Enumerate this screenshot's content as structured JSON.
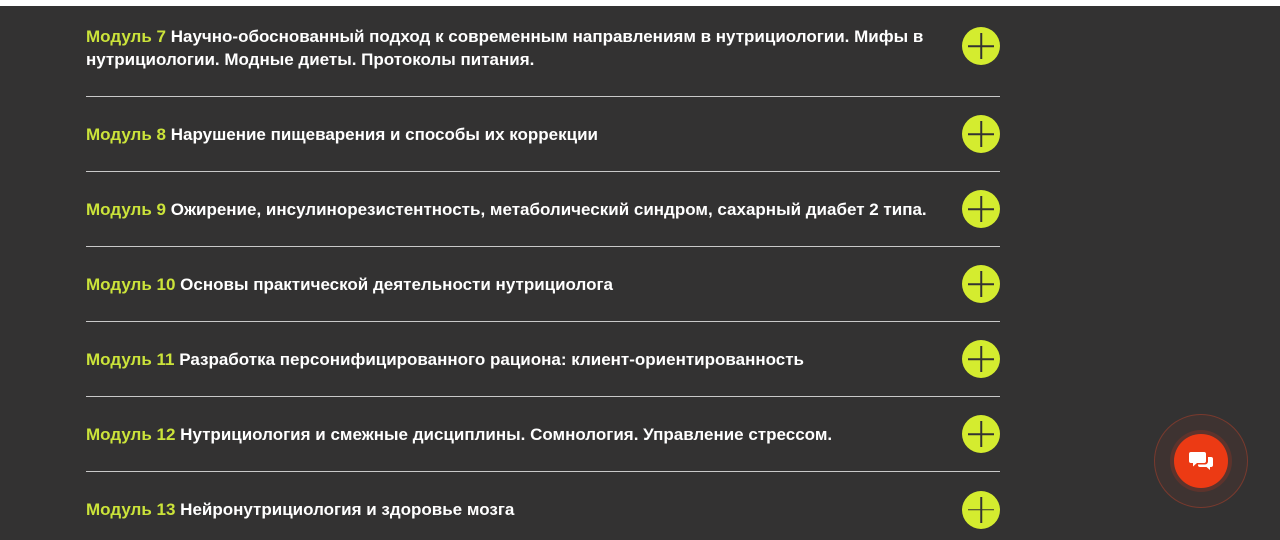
{
  "modules": [
    {
      "num": "Модуль 7",
      "title": "Научно-обоснованный подход к современным направлениям в нутрициологии. Мифы в нутрициологии. Модные диеты. Протоколы питания."
    },
    {
      "num": "Модуль 8",
      "title": "Нарушение пищеварения и способы их коррекции"
    },
    {
      "num": "Модуль 9",
      "title": "Ожирение, инсулинорезистентность, метаболический синдром, сахарный диабет 2 типа."
    },
    {
      "num": "Модуль 10",
      "title": "Основы практической деятельности нутрициолога"
    },
    {
      "num": "Модуль 11",
      "title": "Разработка персонифицированного рациона: клиент-ориентированность"
    },
    {
      "num": "Модуль 12",
      "title": "Нутрициология и смежные дисциплины. Сомнология. Управление стрессом."
    },
    {
      "num": "Модуль 13",
      "title": "Нейронутрициология и здоровье мозга"
    }
  ],
  "icons": {
    "expand": "plus-icon",
    "chat": "chat-bubbles-icon"
  },
  "colors": {
    "background": "#333232",
    "accent": "#d4ec2f",
    "module_label": "#cbe33a",
    "chat_button": "#ec3a14"
  }
}
